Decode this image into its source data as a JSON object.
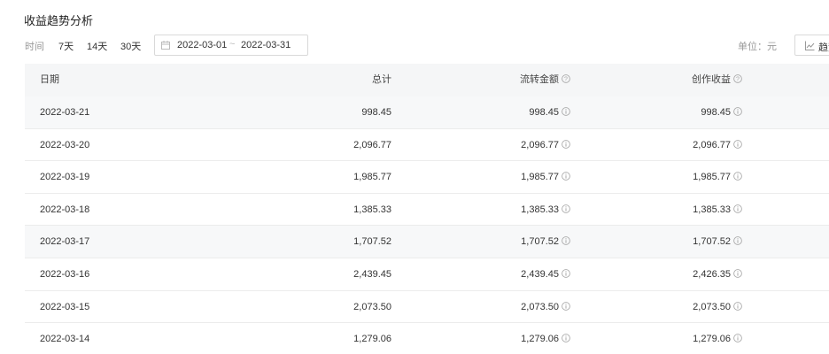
{
  "page": {
    "title": "收益趋势分析"
  },
  "filters": {
    "time_label": "时间",
    "ranges": [
      "7天",
      "14天",
      "30天"
    ],
    "date_start": "2022-03-01",
    "date_sep": "~",
    "date_end": "2022-03-31",
    "unit": "单位：元",
    "trend_button": "趋势"
  },
  "table": {
    "columns": [
      "日期",
      "总计",
      "流转金额",
      "创作收益"
    ],
    "rows": [
      [
        "2022-03-21",
        "998.45",
        "998.45",
        "998.45"
      ],
      [
        "2022-03-20",
        "2,096.77",
        "2,096.77",
        "2,096.77"
      ],
      [
        "2022-03-19",
        "1,985.77",
        "1,985.77",
        "1,985.77"
      ],
      [
        "2022-03-18",
        "1,385.33",
        "1,385.33",
        "1,385.33"
      ],
      [
        "2022-03-17",
        "1,707.52",
        "1,707.52",
        "1,707.52"
      ],
      [
        "2022-03-16",
        "2,439.45",
        "2,439.45",
        "2,426.35"
      ],
      [
        "2022-03-15",
        "2,073.50",
        "2,073.50",
        "2,073.50"
      ],
      [
        "2022-03-14",
        "1,279.06",
        "1,279.06",
        "1,279.06"
      ]
    ]
  }
}
